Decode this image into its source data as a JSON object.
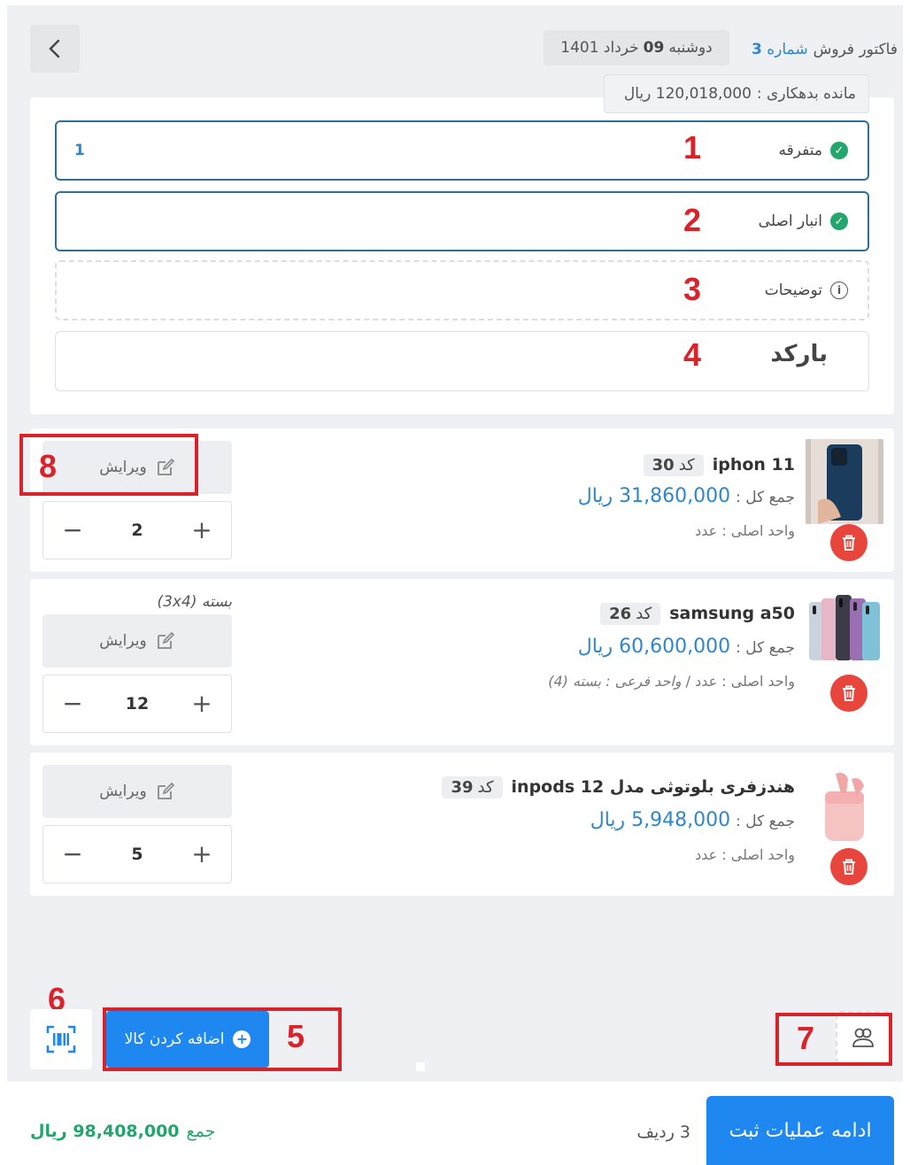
{
  "header": {
    "invoice_type": "فاکتور فروش",
    "invoice_number_label": "شماره",
    "invoice_number": "3",
    "date_prefix": "دوشنبه",
    "day": "09",
    "month_year": "خرداد 1401",
    "debt_label": "مانده بدهکاری :",
    "debt_value": "120,018,000 ریال",
    "back_icon": "chevron-left-icon"
  },
  "form": {
    "customer_label": "متفرقه",
    "customer_value": "1",
    "warehouse_label": "انبار اصلی",
    "notes_label": "توضیحات",
    "barcode_label": "بارکد"
  },
  "annotations": [
    "1",
    "2",
    "3",
    "4",
    "5",
    "6",
    "7",
    "8"
  ],
  "products": [
    {
      "name": "iphon 11",
      "code_label": "کد",
      "code": "30",
      "total_label": "جمع کل :",
      "total": "31,860,000 ریال",
      "unit": "واحد اصلی : عدد",
      "unit_sub": "",
      "pack_note": "",
      "qty": "2",
      "edit_label": "ویرایش",
      "thumb": "phone-blue"
    },
    {
      "name": "samsung a50",
      "code_label": "کد",
      "code": "26",
      "total_label": "جمع کل :",
      "total": "60,600,000 ریال",
      "unit": "واحد اصلی : عدد /",
      "unit_sub": "واحد فرعی : بسته (4)",
      "pack_note": "بسته (3x4)",
      "qty": "12",
      "edit_label": "ویرایش",
      "thumb": "phones-gradient"
    },
    {
      "name": "هندزفری بلوتوثی مدل inpods 12",
      "code_label": "کد",
      "code": "39",
      "total_label": "جمع کل :",
      "total": "5,948,000 ریال",
      "unit": "واحد اصلی : عدد",
      "unit_sub": "",
      "pack_note": "",
      "qty": "5",
      "edit_label": "ویرایش",
      "thumb": "earbuds-pink"
    }
  ],
  "actions": {
    "add_product_label": "اضافه کردن کالا",
    "scan_icon": "barcode-scan-icon",
    "person_icon": "users-icon"
  },
  "footer": {
    "submit_label": "ادامه عملیات ثبت",
    "rows_count": "3",
    "rows_label": "ردیف",
    "grand_total_label": "جمع",
    "grand_total_value": "98,408,000 ریال"
  },
  "colors": {
    "accent": "#1e87f0",
    "link_blue": "#2f86c9",
    "success": "#22a66c",
    "danger": "#e8453c",
    "annotation_red": "#d9232a"
  }
}
